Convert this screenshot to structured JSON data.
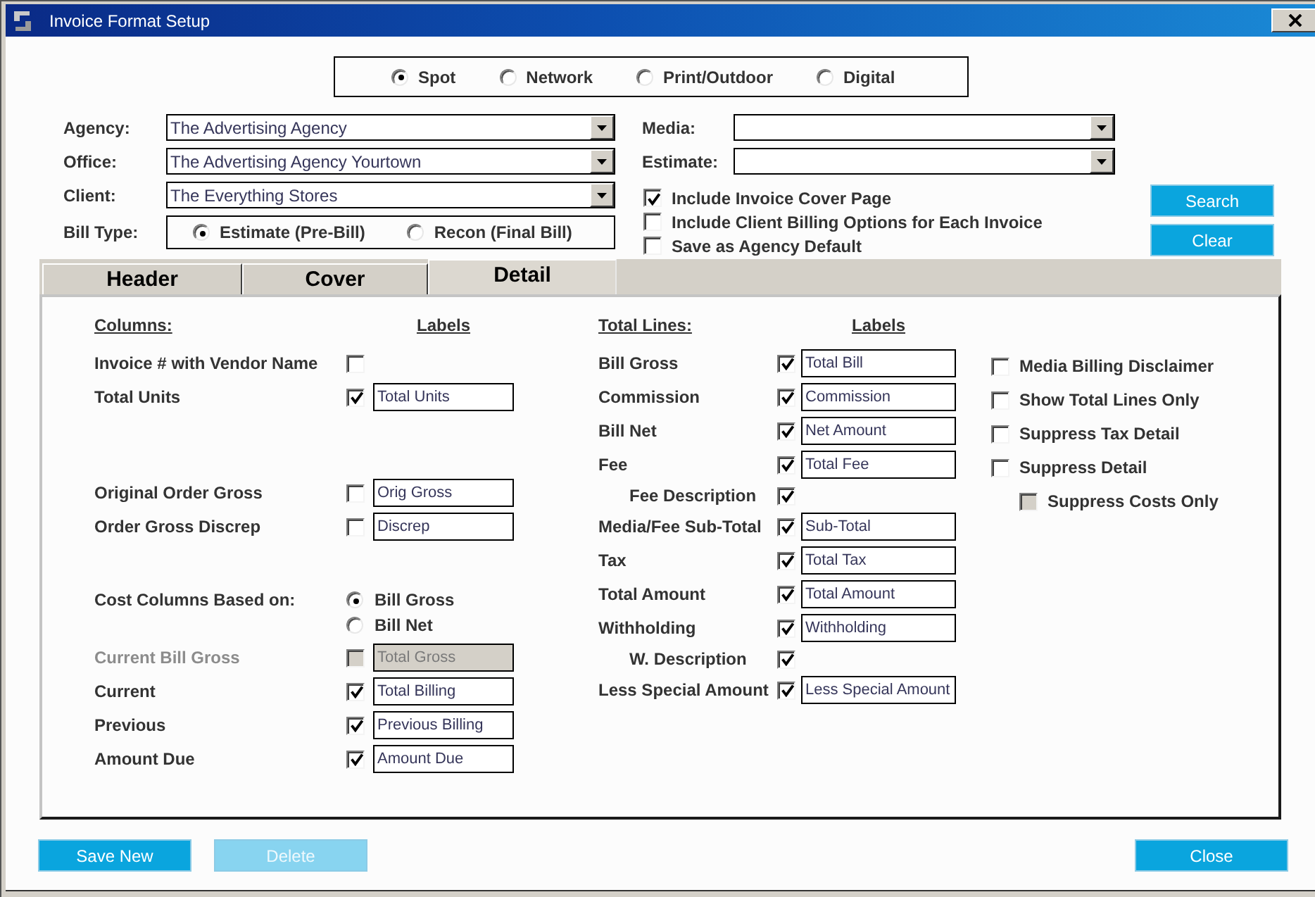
{
  "window": {
    "title": "Invoice Format Setup"
  },
  "media_types": [
    {
      "label": "Spot",
      "selected": true
    },
    {
      "label": "Network",
      "selected": false
    },
    {
      "label": "Print/Outdoor",
      "selected": false
    },
    {
      "label": "Digital",
      "selected": false
    }
  ],
  "filters": [
    {
      "label": "Agency:",
      "value": "The Advertising Agency"
    },
    {
      "label": "Office:",
      "value": "The Advertising Agency Yourtown"
    },
    {
      "label": "Client:",
      "value": "The Everything Stores"
    }
  ],
  "bill_type": {
    "label": "Bill Type:",
    "options": [
      {
        "label": "Estimate (Pre-Bill)",
        "selected": true
      },
      {
        "label": "Recon (Final Bill)",
        "selected": false
      }
    ]
  },
  "media_filters": [
    {
      "label": "Media:"
    },
    {
      "label": "Estimate:"
    }
  ],
  "options": [
    {
      "label": "Include Invoice Cover Page",
      "checked": true
    },
    {
      "label": "Include Client Billing Options for Each Invoice",
      "checked": false
    },
    {
      "label": "Save as Agency Default",
      "checked": false
    }
  ],
  "side_buttons": [
    {
      "label": "Search"
    },
    {
      "label": "Clear"
    }
  ],
  "tabs": [
    {
      "label": "Header",
      "selected": false
    },
    {
      "label": "Cover",
      "selected": false
    },
    {
      "label": "Detail",
      "selected": true
    }
  ],
  "detail": {
    "columns": {
      "heading": "Columns:",
      "labels_heading": "Labels",
      "groups": [
        [
          {
            "kind": "check",
            "label": "Invoice # with Vendor Name",
            "checked": false,
            "disabled": false
          },
          {
            "kind": "check",
            "label": "Total Units",
            "checked": true,
            "disabled": false,
            "value": "Total Units"
          }
        ],
        [
          {
            "kind": "check",
            "label": "Original Order Gross",
            "checked": false,
            "disabled": false,
            "value": "Orig Gross"
          },
          {
            "kind": "check",
            "label": "Order Gross Discrep",
            "checked": false,
            "disabled": false,
            "value": "Discrep"
          }
        ],
        [
          {
            "kind": "radio",
            "label": "Cost Columns Based on:",
            "disabled": false,
            "options": [
              {
                "label": "Bill Gross",
                "selected": true
              },
              {
                "label": "Bill Net",
                "selected": false
              }
            ]
          },
          {
            "kind": "check",
            "label": "Current Bill Gross",
            "checked": false,
            "disabled": true,
            "value": "Total Gross"
          },
          {
            "kind": "check",
            "label": "Current",
            "checked": true,
            "disabled": false,
            "value": "Total Billing"
          },
          {
            "kind": "check",
            "label": "Previous",
            "checked": true,
            "disabled": false,
            "value": "Previous Billing"
          },
          {
            "kind": "check",
            "label": "Amount Due",
            "checked": true,
            "disabled": false,
            "value": "Amount Due"
          }
        ]
      ]
    },
    "total_lines": {
      "heading": "Total Lines:",
      "labels_heading": "Labels",
      "rows": [
        {
          "label": "Bill Gross",
          "checked": true,
          "value": "Total Bill"
        },
        {
          "label": "Commission",
          "checked": true,
          "value": "Commission"
        },
        {
          "label": "Bill Net",
          "checked": true,
          "value": "Net Amount"
        },
        {
          "label": "Fee",
          "checked": true,
          "value": "Total Fee",
          "children": [
            {
              "label": "Fee Description",
              "checked": true
            }
          ]
        },
        {
          "label": "Media/Fee Sub-Total",
          "checked": true,
          "value": "Sub-Total"
        },
        {
          "label": "Tax",
          "checked": true,
          "value": "Total Tax"
        },
        {
          "label": "Total Amount",
          "checked": true,
          "value": "Total Amount"
        },
        {
          "label": "Withholding",
          "checked": true,
          "value": "Withholding",
          "children": [
            {
              "label": "W. Description",
              "checked": true
            }
          ]
        },
        {
          "label": "Less Special Amount",
          "checked": true,
          "value": "Less Special Amount"
        }
      ]
    },
    "display_options": [
      {
        "label": "Media Billing Disclaimer",
        "checked": false,
        "disabled": false
      },
      {
        "label": "Show Total Lines Only",
        "checked": false,
        "disabled": false
      },
      {
        "label": "Suppress Tax Detail",
        "checked": false,
        "disabled": false
      },
      {
        "label": "Suppress Detail",
        "checked": false,
        "disabled": false,
        "children": [
          {
            "label": "Suppress Costs Only",
            "checked": false,
            "disabled": true
          }
        ]
      }
    ]
  },
  "buttons": [
    {
      "label": "Save New",
      "disabled": false
    },
    {
      "label": "Delete",
      "disabled": true
    },
    {
      "label": "Close",
      "disabled": false
    }
  ]
}
